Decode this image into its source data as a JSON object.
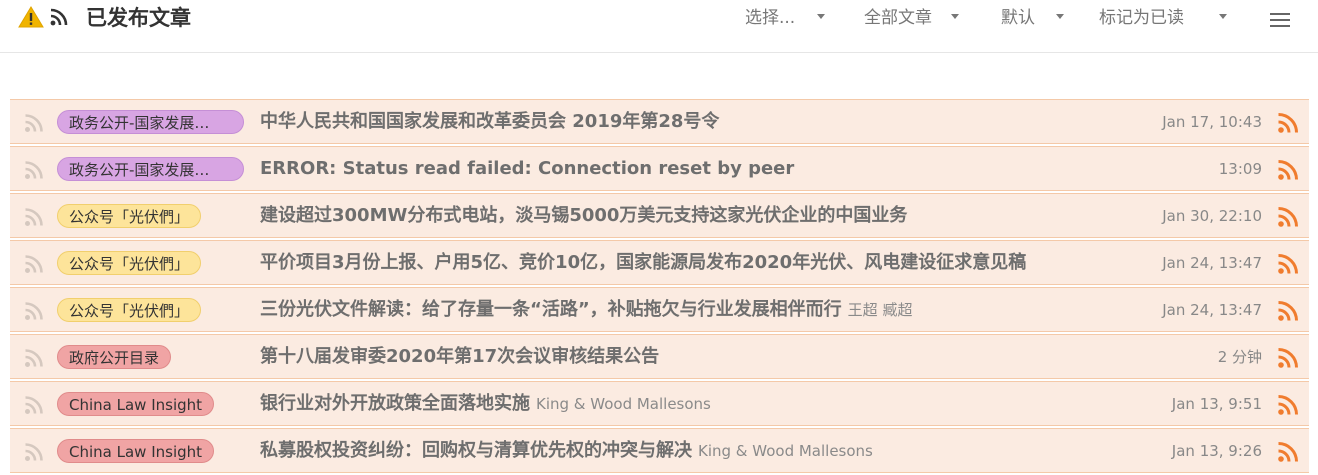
{
  "header": {
    "title": "已发布文章",
    "menus": [
      {
        "label": "选择..."
      },
      {
        "label": "全部文章"
      },
      {
        "label": "默认"
      },
      {
        "label": "标记为已读"
      }
    ]
  },
  "colors": {
    "warning": "#f0b400",
    "rss": "#f07c2e",
    "row_bg": "#fbebe1",
    "tag_purple": "#d8a5e3",
    "tag_yellow": "#fde49a",
    "tag_red": "#f0a4a4"
  },
  "articles": [
    {
      "tag": "政务公开-国家发展…",
      "tag_color": "purple",
      "title": "中华人民共和国国家发展和改革委员会 2019年第28号令",
      "author": "",
      "time": "Jan 17, 10:43"
    },
    {
      "tag": "政务公开-国家发展…",
      "tag_color": "purple",
      "title": "ERROR: Status read failed: Connection reset by peer",
      "author": "",
      "time": "13:09"
    },
    {
      "tag": "公众号「光伏們」",
      "tag_color": "yellow",
      "title": "建设超过300MW分布式电站，淡马锡5000万美元支持这家光伏企业的中国业务",
      "author": "",
      "time": "Jan 30, 22:10"
    },
    {
      "tag": "公众号「光伏們」",
      "tag_color": "yellow",
      "title": "平价项目3月份上报、户用5亿、竞价10亿，国家能源局发布2020年光伏、风电建设征求意见稿",
      "author": "",
      "time": "Jan 24, 13:47"
    },
    {
      "tag": "公众号「光伏們」",
      "tag_color": "yellow",
      "title": "三份光伏文件解读：给了存量一条“活路”，补贴拖欠与行业发展相伴而行",
      "author": "王超 臧超",
      "time": "Jan 24, 13:47"
    },
    {
      "tag": "政府公开目录",
      "tag_color": "red",
      "title": "第十八届发审委2020年第17次会议审核结果公告",
      "author": "",
      "time": "2 分钟"
    },
    {
      "tag": "China Law Insight",
      "tag_color": "red",
      "title": "银行业对外开放政策全面落地实施",
      "author": "King & Wood Mallesons",
      "time": "Jan 13, 9:51"
    },
    {
      "tag": "China Law Insight",
      "tag_color": "red",
      "title": "私募股权投资纠纷：回购权与清算优先权的冲突与解决",
      "author": "King & Wood Mallesons",
      "time": "Jan 13, 9:26"
    }
  ]
}
